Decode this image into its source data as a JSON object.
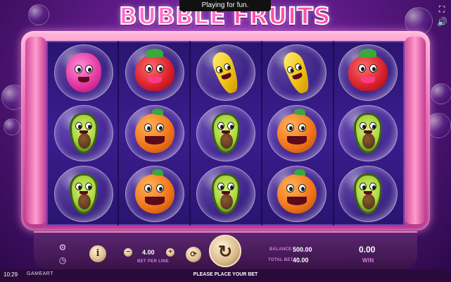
{
  "notice": "Playing for fun.",
  "logo": {
    "word1": "BUBBLE",
    "word2": "FRUITS"
  },
  "controls": {
    "fullscreen_icon": "fullscreen-icon",
    "sound_icon": "sound-icon"
  },
  "reels": {
    "rows": [
      [
        "raspberry",
        "strawberry",
        "banana",
        "banana",
        "strawberry"
      ],
      [
        "avocado",
        "orange",
        "avocado",
        "orange",
        "avocado"
      ],
      [
        "avocado",
        "orange",
        "avocado",
        "orange",
        "avocado"
      ]
    ]
  },
  "panel": {
    "info_label": "i",
    "bet_per_line_value": "4.00",
    "bet_per_line_label": "BET PER LINE",
    "minus_label": "−",
    "plus_label": "+",
    "balance_label": "BALANCE",
    "balance_value": "500.00",
    "total_bet_label": "TOTAL BET",
    "total_bet_value": "40.00",
    "win_value": "0.00",
    "win_label": "WIN"
  },
  "status": "PLEASE PLACE YOUR BET",
  "clock": "10:29",
  "brand": "GAMEART",
  "colors": {
    "accent": "#ff6fc7",
    "win": "#d27fe0",
    "panel": "#3a1348"
  }
}
